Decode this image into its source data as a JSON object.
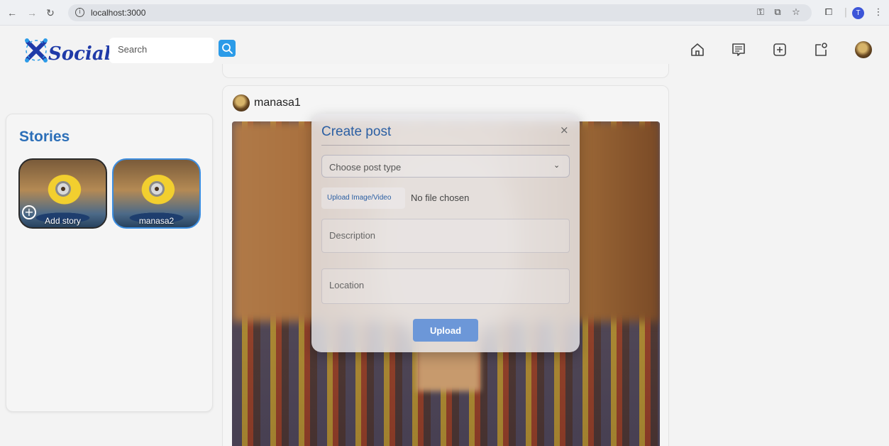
{
  "browser": {
    "url": "localhost:3000",
    "profile_initial": "T"
  },
  "header": {
    "logo_text": "SocialX",
    "search_placeholder": "Search"
  },
  "stories": {
    "title": "Stories",
    "items": [
      {
        "label": "Add story"
      },
      {
        "label": "manasa2"
      }
    ]
  },
  "post": {
    "username": "manasa1"
  },
  "modal": {
    "title": "Create post",
    "close_glyph": "×",
    "post_type_placeholder": "Choose post type",
    "upload_label": "Upload Image/Video",
    "file_status": "No file chosen",
    "description_placeholder": "Description",
    "location_placeholder": "Location",
    "submit_label": "Upload"
  },
  "colors": {
    "accent": "#2b5fa3",
    "stories_title": "#2c6fb8",
    "search_button": "#2b9be8",
    "upload_button": "#6c97d8"
  }
}
